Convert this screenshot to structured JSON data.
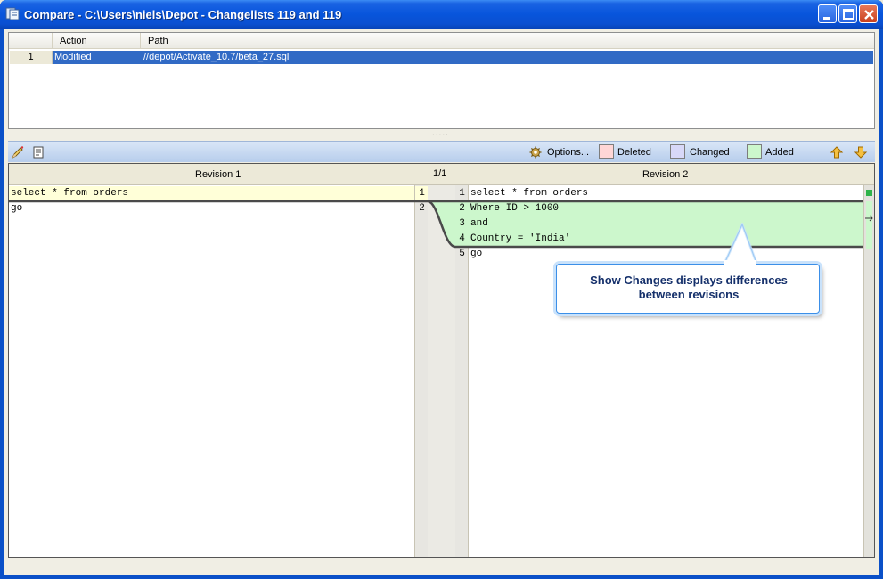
{
  "window": {
    "title": "Compare - C:\\Users\\niels\\Depot - Changelists 119 and 119"
  },
  "file_list": {
    "columns": {
      "action": "Action",
      "path": "Path"
    },
    "rows": [
      {
        "index": "1",
        "action": "Modified",
        "path": "//depot/Activate_10.7/beta_27.sql"
      }
    ],
    "splitter": "....."
  },
  "toolbar": {
    "options_label": "Options...",
    "legend": {
      "deleted": {
        "label": "Deleted",
        "color": "#ffd6d6"
      },
      "changed": {
        "label": "Changed",
        "color": "#d8d8f8"
      },
      "added": {
        "label": "Added",
        "color": "#ccf7cc"
      }
    }
  },
  "diff": {
    "left_title": "Revision 1",
    "right_title": "Revision 2",
    "counter": "1/1",
    "left_lines": [
      {
        "num": "1",
        "text": "select * from orders"
      },
      {
        "num": "2",
        "text": "go"
      }
    ],
    "right_lines": [
      {
        "num": "1",
        "text": "select * from orders"
      },
      {
        "num": "2",
        "text": "Where ID > 1000"
      },
      {
        "num": "3",
        "text": "and"
      },
      {
        "num": "4",
        "text": "Country = 'India'"
      },
      {
        "num": "5",
        "text": "go"
      }
    ]
  },
  "callout": {
    "line1": "Show Changes displays differences",
    "line2": "between revisions"
  }
}
